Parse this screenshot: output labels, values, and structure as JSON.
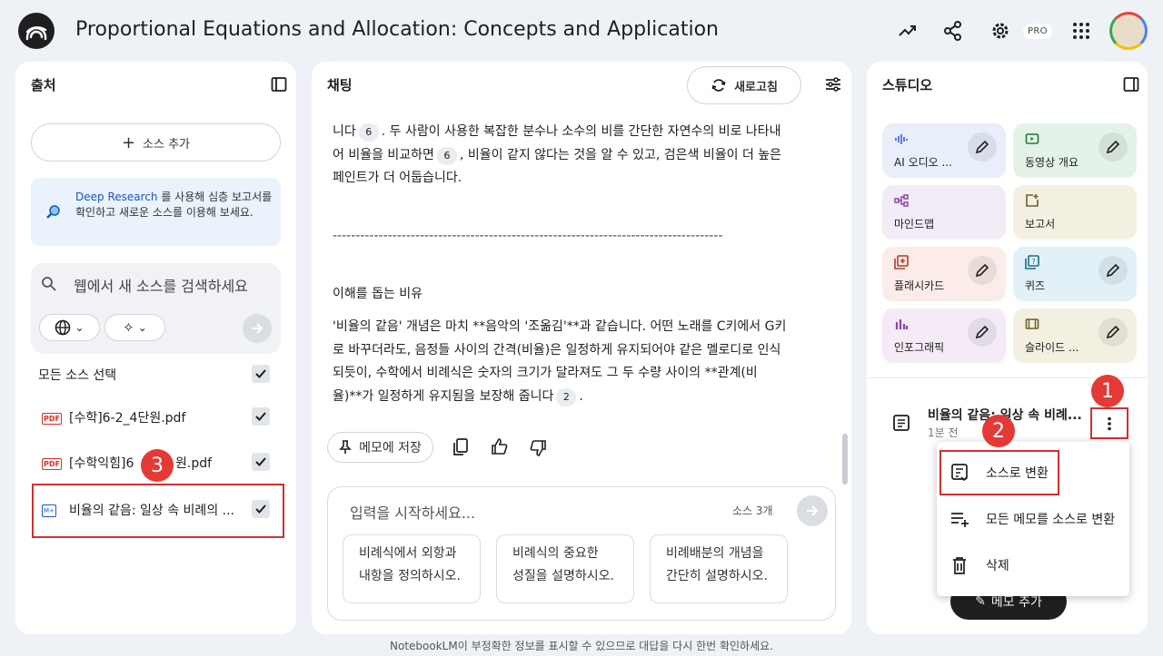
{
  "app": {
    "title": "Proportional Equations and Allocation: Concepts and Application",
    "pro_badge": "PRO",
    "footer": "NotebookLM이 부정확한 정보를 표시할 수 있으므로 대답을 다시 한번 확인하세요."
  },
  "sources": {
    "title": "출처",
    "add_label": "소스 추가",
    "deep_research_link": "Deep Research",
    "deep_research_text": "를 사용해 심층 보고서를 확인하고 새로운 소스를 이용해 보세요.",
    "search_placeholder": "웹에서 새 소스를 검색하세요",
    "select_all": "모든 소스 선택",
    "items": [
      {
        "name": "[수학]6-2_4단원.pdf",
        "type": "PDF"
      },
      {
        "name_a": "[수학익힘]6",
        "name_b": "원.pdf",
        "type": "PDF"
      },
      {
        "name": "비율의 같음: 일상 속 비례의 ...",
        "type": "M+"
      }
    ]
  },
  "chat": {
    "title": "채팅",
    "refresh_label": "새로고침",
    "p1a": "니다",
    "ref1": "6",
    "p1b": ". 두 사람이 사용한 복잡한 분수나 소수의 비를 간단한 자연수의 비로 나타내어 비율을 비교하면",
    "ref2": "6",
    "p1c": ", 비율이 같지 않다는 것을 알 수 있고, 검은색 비율이 더 높은 페인트가 더 어둡습니다.",
    "divider": "-------------------------------------------------------------------------------------",
    "heading": "이해를 돕는 비유",
    "p2": "'비율의 같음' 개념은 마치 **음악의 '조옮김'**과 같습니다. 어떤 노래를 C키에서 G키로 바꾸더라도, 음정들 사이의 간격(비율)은 일정하게 유지되어야 같은 멜로디로 인식되듯이, 수학에서 비례식은 숫자의 크기가 달라져도 그 두 수량 사이의 **관계(비율)**가 일정하게 유지됨을 보장해 줍니다",
    "ref3": "2",
    "p2end": ".",
    "save_memo": "메모에 저장",
    "input_placeholder": "입력을 시작하세요...",
    "source_count": "소스 3개",
    "suggestions": [
      {
        "l1": "비례식에서 외항과",
        "l2": "내항을 정의하시오."
      },
      {
        "l1": "비례식의 중요한",
        "l2": "성질을 설명하시오."
      },
      {
        "l1": "비례배분의 개념을",
        "l2": "간단히 설명하시오."
      }
    ]
  },
  "studio": {
    "title": "스튜디오",
    "cards": [
      {
        "label": "AI 오디오 ...",
        "color": "#e9eefb"
      },
      {
        "label": "동영상 개요",
        "color": "#e4f2e8"
      },
      {
        "label": "마인드맵",
        "color": "#f2ecf6"
      },
      {
        "label": "보고서",
        "color": "#f3f0e2"
      },
      {
        "label": "플래시카드",
        "color": "#fbece9"
      },
      {
        "label": "퀴즈",
        "color": "#e2f1f8"
      },
      {
        "label": "인포그래픽",
        "color": "#f4ebf6"
      },
      {
        "label": "슬라이드 ...",
        "color": "#f3f0e2"
      }
    ],
    "note_title": "비율의 같음: 일상 속 비례...",
    "note_time": "1분 전",
    "add_note": "메모 추가",
    "menu": [
      "소스로 변환",
      "모든 메모를 소스로 변환",
      "삭제"
    ]
  },
  "badges": [
    "1",
    "2",
    "3"
  ]
}
